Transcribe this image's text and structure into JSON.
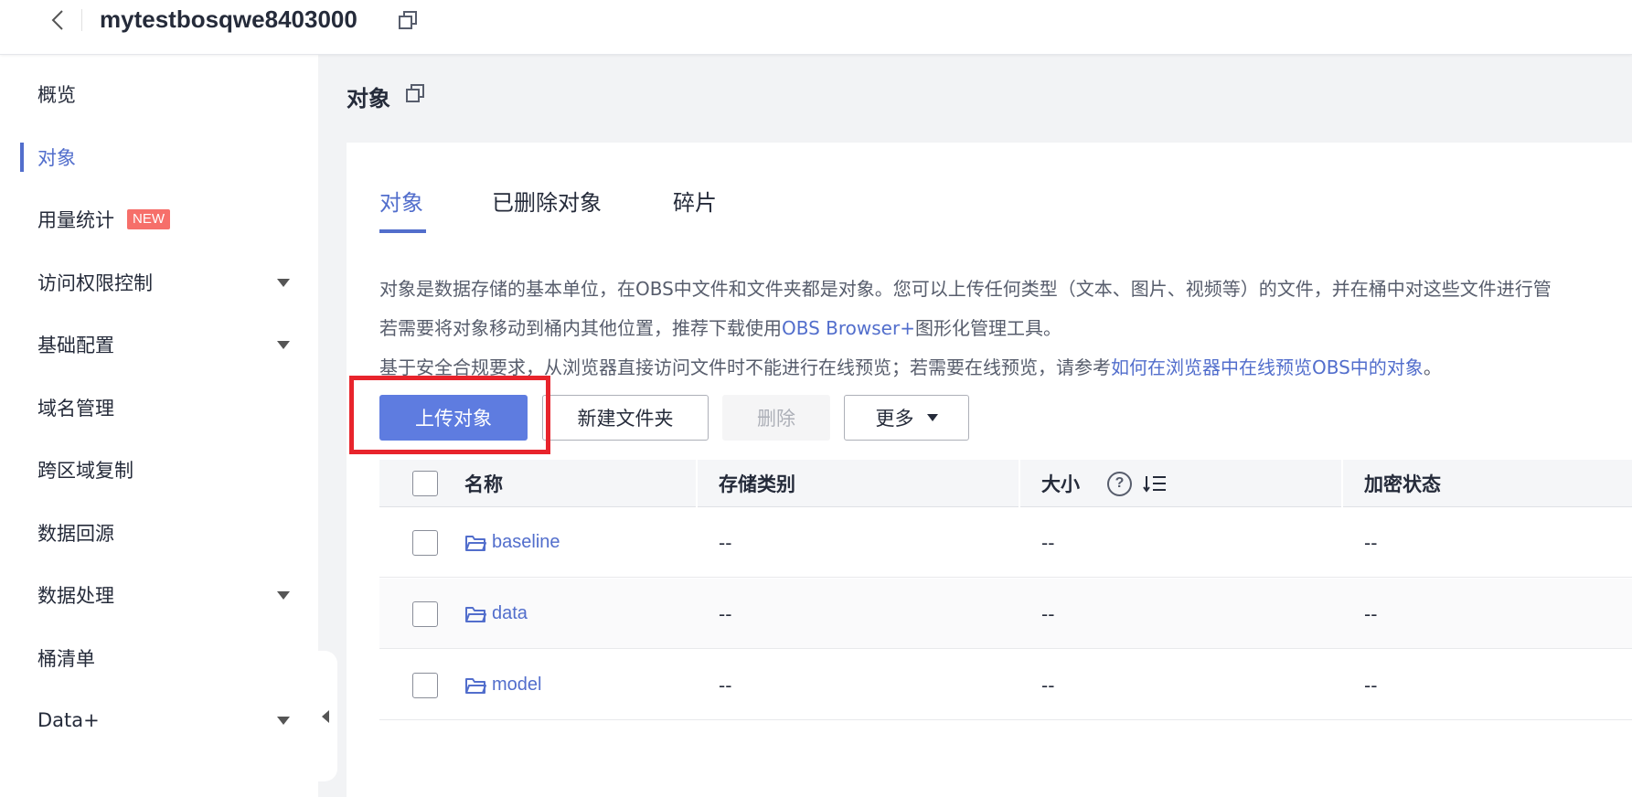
{
  "header": {
    "bucket_name": "mytestbosqwe8403000"
  },
  "sidebar": {
    "items": [
      {
        "label": "概览"
      },
      {
        "label": "对象",
        "active": true
      },
      {
        "label": "用量统计",
        "badge": "NEW"
      },
      {
        "label": "访问权限控制",
        "expandable": true
      },
      {
        "label": "基础配置",
        "expandable": true
      },
      {
        "label": "域名管理"
      },
      {
        "label": "跨区域复制"
      },
      {
        "label": "数据回源"
      },
      {
        "label": "数据处理",
        "expandable": true
      },
      {
        "label": "桶清单"
      },
      {
        "label": "Data+",
        "expandable": true
      }
    ]
  },
  "main": {
    "title": "对象",
    "tabs": [
      {
        "label": "对象",
        "active": true
      },
      {
        "label": "已删除对象"
      },
      {
        "label": "碎片"
      }
    ],
    "description": {
      "line1": "对象是数据存储的基本单位，在OBS中文件和文件夹都是对象。您可以上传任何类型（文本、图片、视频等）的文件，并在桶中对这些文件进行管",
      "line2_before": "若需要将对象移动到桶内其他位置，推荐下载使用",
      "line2_link": "OBS Browser+",
      "line2_after": "图形化管理工具。",
      "line3_before": "基于安全合规要求，从浏览器直接访问文件时不能进行在线预览；若需要在线预览，请参考",
      "line3_link": "如何在浏览器中在线预览OBS中的对象",
      "line3_after": "。"
    },
    "buttons": {
      "upload": "上传对象",
      "new_folder": "新建文件夹",
      "delete": "删除",
      "more": "更多"
    },
    "table": {
      "columns": {
        "name": "名称",
        "storage_class": "存储类别",
        "size": "大小",
        "encryption": "加密状态"
      },
      "rows": [
        {
          "name": "baseline",
          "storage_class": "--",
          "size": "--",
          "encryption": "--"
        },
        {
          "name": "data",
          "storage_class": "--",
          "size": "--",
          "encryption": "--"
        },
        {
          "name": "model",
          "storage_class": "--",
          "size": "--",
          "encryption": "--"
        }
      ]
    }
  },
  "colors": {
    "accent": "#526ecc",
    "primary_button": "#5e7ce0",
    "highlight_box": "#e8242c",
    "badge": "#f66f6a"
  },
  "icons": [
    "back-arrow-icon",
    "copy-icon",
    "dropdown-caret-icon",
    "collapse-sidebar-icon",
    "help-icon",
    "sort-icon",
    "folder-icon"
  ]
}
